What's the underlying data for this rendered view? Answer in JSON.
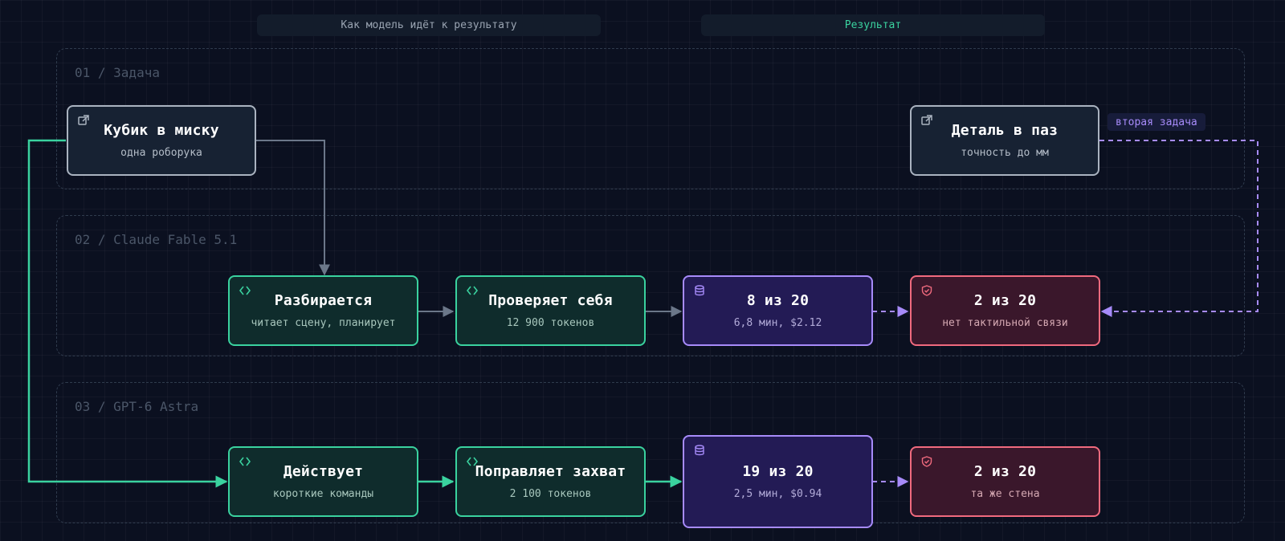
{
  "headers": {
    "process": "Как модель идёт к результату",
    "result": "Результат"
  },
  "lanes": [
    {
      "label": "01 / Задача"
    },
    {
      "label": "02 / Claude Fable 5.1"
    },
    {
      "label": "03 / GPT-6 Astra"
    }
  ],
  "nodes": {
    "task_cube": {
      "title": "Кубик в миску",
      "sub": "одна роборука",
      "icon": "external-link-icon"
    },
    "task_part": {
      "title": "Деталь в паз",
      "sub": "точность до мм",
      "icon": "external-link-icon"
    },
    "fable_step1": {
      "title": "Разбирается",
      "sub": "читает сцену, планирует",
      "icon": "code-icon"
    },
    "fable_step2": {
      "title": "Проверяет себя",
      "sub": "12 900 токенов",
      "icon": "code-icon"
    },
    "fable_metric": {
      "title": "8 из 20",
      "sub": "6,8 мин, $2.12",
      "icon": "database-icon"
    },
    "fable_fail": {
      "title": "2 из 20",
      "sub": "нет тактильной связи",
      "icon": "shield-icon"
    },
    "astra_step1": {
      "title": "Действует",
      "sub": "короткие команды",
      "icon": "code-icon"
    },
    "astra_step2": {
      "title": "Поправляет захват",
      "sub": "2 100 токенов",
      "icon": "code-icon"
    },
    "astra_metric": {
      "title": "19 из 20",
      "sub": "2,5 мин, $0.94",
      "icon": "database-icon"
    },
    "astra_fail": {
      "title": "2 из 20",
      "sub": "та же стена",
      "icon": "shield-icon"
    }
  },
  "edge_labels": {
    "second_task": "вторая задача"
  },
  "colors": {
    "background": "#0b1020",
    "green": "#3ad29f",
    "purple": "#a78bfa",
    "red": "#f06a7e",
    "gray": "#6b7789"
  }
}
